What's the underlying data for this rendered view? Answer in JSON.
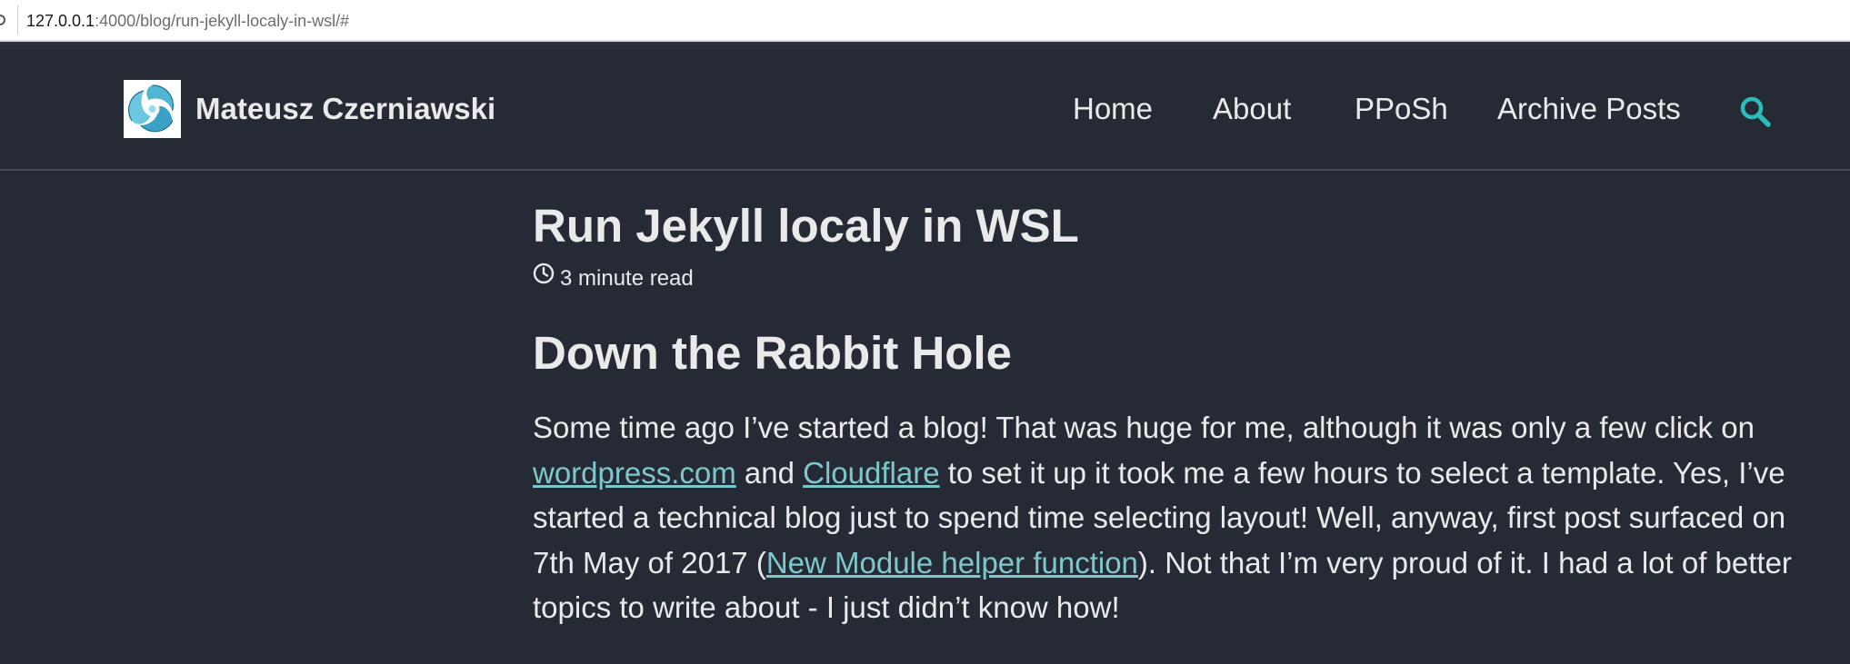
{
  "browser": {
    "url_host": "127.0.0.1",
    "url_path": ":4000/blog/run-jekyll-localy-in-wsl/#"
  },
  "site": {
    "title": "Mateusz Czerniawski",
    "nav": [
      {
        "label": "Home"
      },
      {
        "label": "About"
      },
      {
        "label": "PPoSh"
      },
      {
        "label": "Archive Posts"
      }
    ],
    "search_icon": "search-icon",
    "accent_color": "#2bbcbc"
  },
  "post": {
    "title": "Run Jekyll localy in WSL",
    "read_time": "3 minute read",
    "section_heading": "Down the Rabbit Hole",
    "paragraph": {
      "t1": "Some time ago I’ve started a blog! That was huge for me, although it was only a few click on ",
      "link1": "wordpress.com",
      "t2": " and ",
      "link2": "Cloudflare",
      "t3": " to set it up it took me a few hours to select a template. Yes, I’ve started a technical blog just to spend time selecting layout! Well, anyway, first post surfaced on 7th May of 2017 (",
      "link3": "New Module helper function",
      "t4": "). Not that I’m very proud of it. I had a lot of better topics to write about - I just didn’t know how!"
    }
  },
  "colors": {
    "background": "#252a34",
    "text": "#eaeaea",
    "link": "#7ec8cc"
  }
}
